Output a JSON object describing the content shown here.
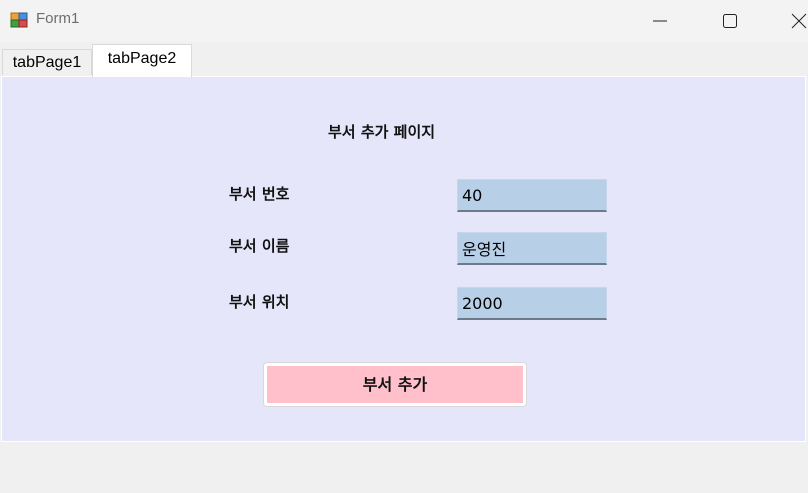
{
  "window": {
    "title": "Form1",
    "icons": {
      "app": "winforms-app-icon",
      "minimize": "minimize-icon",
      "maximize": "maximize-icon",
      "close": "close-icon"
    }
  },
  "tabs": [
    {
      "label": "tabPage1",
      "selected": false
    },
    {
      "label": "tabPage2",
      "selected": true
    }
  ],
  "page": {
    "title": "부서 추가 페이지",
    "fields": {
      "dept_no": {
        "label": "부서 번호",
        "value": "40"
      },
      "dept_name": {
        "label": "부서 이름",
        "value": "운영진"
      },
      "dept_loc": {
        "label": "부서 위치",
        "value": "2000"
      }
    },
    "submit_label": "부서 추가"
  },
  "colors": {
    "page_background": "#e6e6fa",
    "input_background": "#b8cfe8",
    "button_background": "#ffc0cb"
  }
}
